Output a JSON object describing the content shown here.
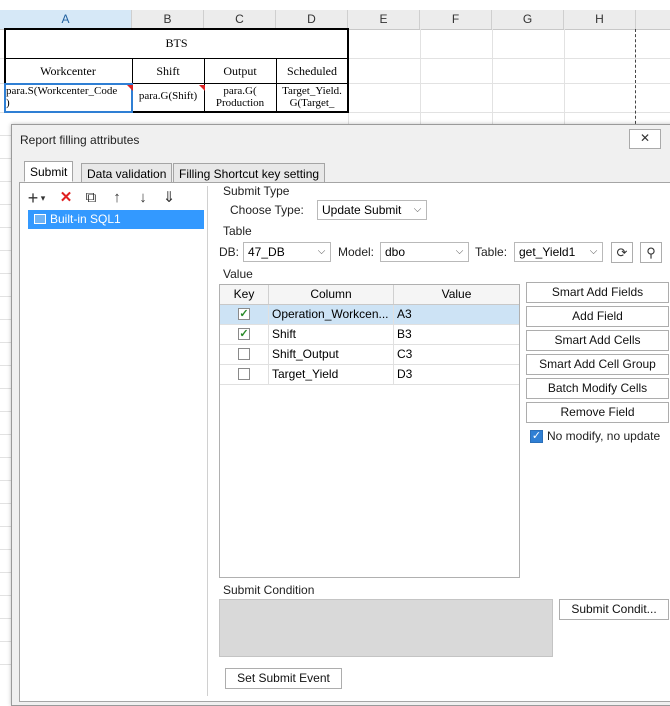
{
  "sheet": {
    "columns": [
      "A",
      "B",
      "C",
      "D",
      "E",
      "F",
      "G",
      "H"
    ],
    "title": "BTS",
    "headers": [
      "Workcenter",
      "Shift",
      "Output",
      "Scheduled"
    ],
    "row3": [
      "para.S(Workcenter_Code",
      ")",
      "para.G(Shift)",
      "para.G(",
      "Production",
      "Target_Yield.",
      "G(Target_"
    ]
  },
  "dialog": {
    "title": "Report filling attributes",
    "close_glyph": "✕",
    "tabs": [
      "Submit",
      "Data validation",
      "Filling Shortcut key setting"
    ],
    "toolbar_icons": [
      "+",
      "▾",
      "✕",
      "⧉",
      "↑",
      "↓",
      "⇓"
    ],
    "list_items": [
      "Built-in SQL1"
    ],
    "submit_type": {
      "section": "Submit Type",
      "choose_label": "Choose Type:",
      "choose_value": "Update Submit"
    },
    "table": {
      "section": "Table",
      "db_label": "DB:",
      "db_value": "47_DB",
      "model_label": "Model:",
      "model_value": "dbo",
      "table_label": "Table:",
      "table_value": "get_Yield1"
    },
    "value": {
      "section": "Value",
      "columns": [
        "Key",
        "Column",
        "Value"
      ],
      "rows": [
        {
          "key": true,
          "column": "Operation_Workcen...",
          "value": "A3"
        },
        {
          "key": true,
          "column": "Shift",
          "value": "B3"
        },
        {
          "key": false,
          "column": "Shift_Output",
          "value": "C3"
        },
        {
          "key": false,
          "column": "Target_Yield",
          "value": "D3"
        }
      ]
    },
    "buttons": [
      "Smart Add Fields",
      "Add Field",
      "Smart Add Cells",
      "Smart Add Cell Group",
      "Batch Modify Cells",
      "Remove Field"
    ],
    "no_modify_label": "No modify, no update",
    "condition": {
      "section": "Submit Condition",
      "button": "Submit Condit..."
    },
    "event_button": "Set Submit Event"
  },
  "colors": {
    "selection": "#3399ff",
    "accent": "#2f7fd4",
    "check": "#2a8a2a",
    "error": "#d22222"
  }
}
